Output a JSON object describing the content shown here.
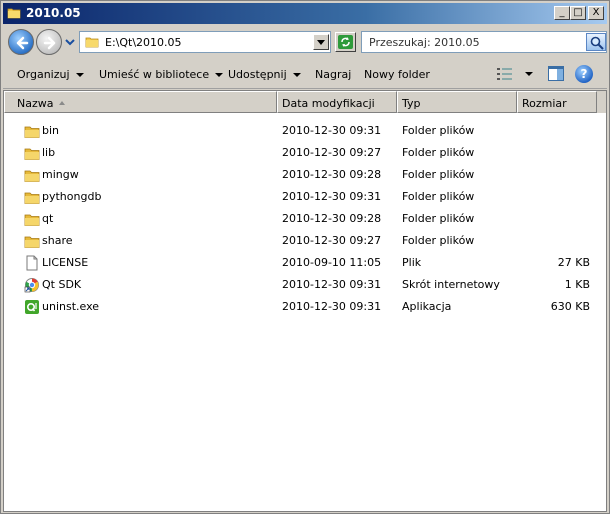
{
  "window": {
    "title": "2010.05",
    "buttons": {
      "minimize": "_",
      "maximize": "□",
      "close": "X"
    }
  },
  "address": {
    "path": "E:\\Qt\\2010.05",
    "search_placeholder": "Przeszukaj: 2010.05"
  },
  "toolbar": {
    "organize": "Organizuj",
    "include_in_library": "Umieść w bibliotece",
    "share": "Udostępnij",
    "burn": "Nagraj",
    "new_folder": "Nowy folder"
  },
  "columns": {
    "name": "Nazwa",
    "date": "Data modyfikacji",
    "type": "Typ",
    "size": "Rozmiar"
  },
  "files": [
    {
      "icon": "folder-icon",
      "name": "bin",
      "date": "2010-12-30 09:31",
      "type": "Folder plików",
      "size": ""
    },
    {
      "icon": "folder-icon",
      "name": "lib",
      "date": "2010-12-30 09:27",
      "type": "Folder plików",
      "size": ""
    },
    {
      "icon": "folder-icon",
      "name": "mingw",
      "date": "2010-12-30 09:28",
      "type": "Folder plików",
      "size": ""
    },
    {
      "icon": "folder-icon",
      "name": "pythongdb",
      "date": "2010-12-30 09:31",
      "type": "Folder plików",
      "size": ""
    },
    {
      "icon": "folder-icon",
      "name": "qt",
      "date": "2010-12-30 09:28",
      "type": "Folder plików",
      "size": ""
    },
    {
      "icon": "folder-icon",
      "name": "share",
      "date": "2010-12-30 09:27",
      "type": "Folder plików",
      "size": ""
    },
    {
      "icon": "file-icon",
      "name": "LICENSE",
      "date": "2010-09-10 11:05",
      "type": "Plik",
      "size": "27 KB"
    },
    {
      "icon": "internet-shortcut-icon",
      "name": "Qt SDK",
      "date": "2010-12-30 09:31",
      "type": "Skrót internetowy",
      "size": "1 KB"
    },
    {
      "icon": "qt-app-icon",
      "name": "uninst.exe",
      "date": "2010-12-30 09:31",
      "type": "Aplikacja",
      "size": "630 KB"
    }
  ]
}
